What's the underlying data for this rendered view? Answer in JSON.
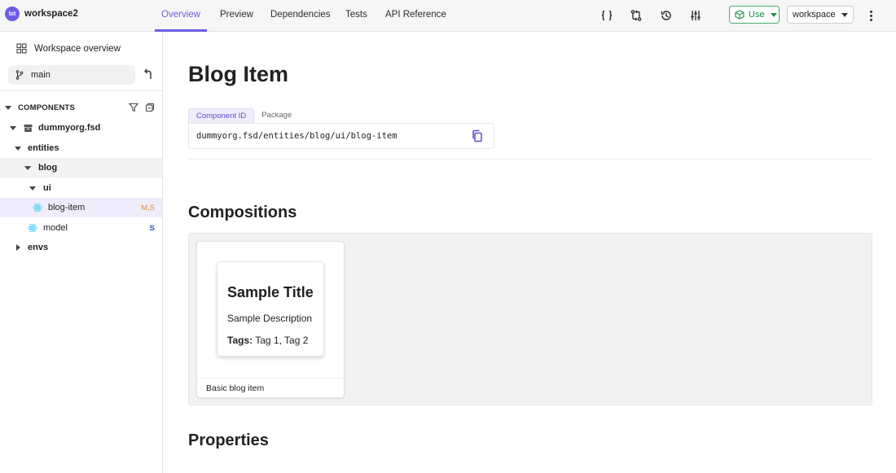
{
  "topbar": {
    "brand_logo": "bit",
    "workspace_name": "workspace2",
    "tabs": [
      {
        "label": "Overview",
        "active": true
      },
      {
        "label": "Preview",
        "active": false
      },
      {
        "label": "Dependencies",
        "active": false
      },
      {
        "label": "Tests",
        "active": false
      },
      {
        "label": "API Reference",
        "active": false
      }
    ],
    "icons": [
      "braces-icon",
      "compare-icon",
      "history-icon",
      "sliders-icon"
    ],
    "use_label": "Use",
    "workspace_select": "workspace",
    "accent_color": "#6c5ce7"
  },
  "sidebar": {
    "overview_label": "Workspace overview",
    "branch": "main",
    "components_header": "COMPONENTS",
    "tree": [
      {
        "label": "dummyorg.fsd",
        "level": 1
      },
      {
        "label": "entities",
        "level": 2
      },
      {
        "label": "blog",
        "level": 3
      },
      {
        "label": "ui",
        "level": 4
      },
      {
        "label": "blog-item",
        "level": 5,
        "badge": "M,S"
      },
      {
        "label": "model",
        "level": 3,
        "badge": "S"
      },
      {
        "label": "envs",
        "level": 2
      }
    ]
  },
  "main": {
    "title": "Blog Item",
    "id_tabs": [
      "Component ID",
      "Package"
    ],
    "component_id": "dummyorg.fsd/entities/blog/ui/blog-item",
    "compositions_title": "Compositions",
    "composition": {
      "preview_title": "Sample Title",
      "preview_description": "Sample Description",
      "preview_tags_label": "Tags:",
      "preview_tags_value": "Tag 1, Tag 2",
      "caption": "Basic blog item"
    },
    "properties_title": "Properties"
  }
}
